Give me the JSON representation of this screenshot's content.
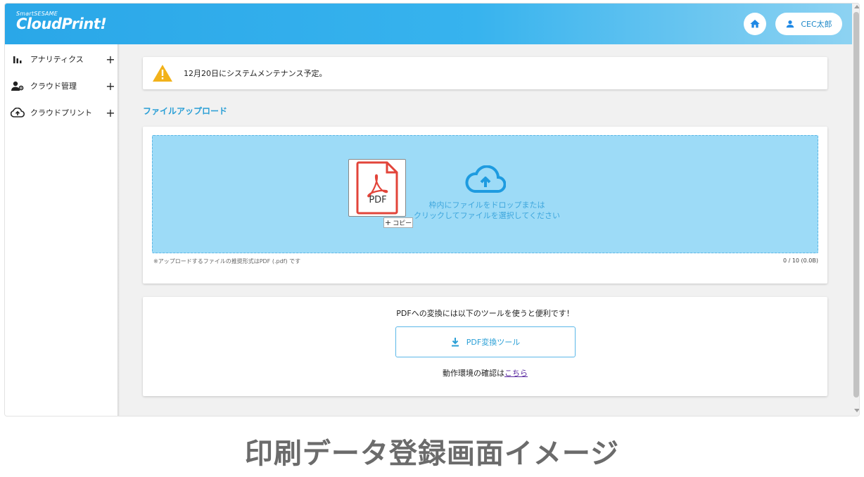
{
  "header": {
    "logo_small": "SmartSESAME",
    "logo_big": "CloudPrint!",
    "user_name": "CEC太郎",
    "accent": "#2aa7e8"
  },
  "sidebar": {
    "items": [
      {
        "label": "アナリティクス",
        "icon": "bar-chart-icon"
      },
      {
        "label": "クラウド管理",
        "icon": "user-gear-icon"
      },
      {
        "label": "クラウドプリント",
        "icon": "cloud-upload-icon"
      }
    ],
    "expand_symbol": "+"
  },
  "notice": {
    "text": "12月20日にシステムメンテナンス予定。",
    "icon": "warning-icon"
  },
  "upload": {
    "section_title": "ファイルアップロード",
    "pdf_label": "PDF",
    "copy_label": "コピー",
    "drop_line1": "枠内にファイルをドロップまたは",
    "drop_line2": "クリックしてファイルを選択してください",
    "note": "※アップロードするファイルの推奨形式はPDF (.pdf) です",
    "count": "0 / 10 (0.0B)"
  },
  "tool": {
    "text": "PDFへの変換には以下のツールを使うと便利です！",
    "button_label": "PDF変換ツール",
    "env_prefix": "動作環境の確認は",
    "env_link": "こちら"
  },
  "caption": "印刷データ登録画面イメージ"
}
